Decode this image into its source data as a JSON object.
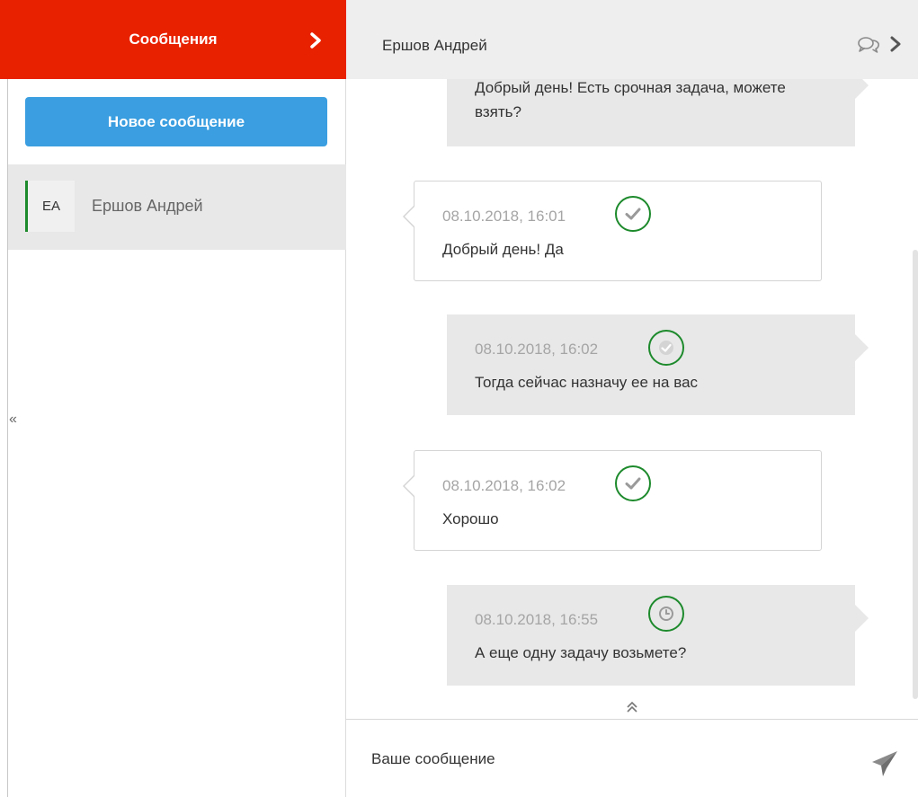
{
  "sidebar": {
    "title": "Сообщения",
    "new_message_label": "Новое сообщение",
    "contacts": [
      {
        "initials": "ЕА",
        "name": "Ершов Андрей"
      }
    ],
    "collapse_glyph": "«"
  },
  "chat": {
    "title": "Ершов Андрей",
    "messages": [
      {
        "direction": "out",
        "time": "",
        "text": "Добрый день! Есть срочная задача, можете взять?",
        "status": ""
      },
      {
        "direction": "in",
        "time": "08.10.2018, 16:01",
        "text": "Добрый день! Да",
        "status": "check-icon"
      },
      {
        "direction": "out",
        "time": "08.10.2018, 16:02",
        "text": "Тогда сейчас назначу ее на вас",
        "status": "check-icon"
      },
      {
        "direction": "in",
        "time": "08.10.2018, 16:02",
        "text": "Хорошо",
        "status": "check-icon"
      },
      {
        "direction": "out",
        "time": "08.10.2018, 16:55",
        "text": "А еще одну задачу возьмете?",
        "status": "clock-icon"
      }
    ],
    "composer": {
      "placeholder": "Ваше сообщение"
    }
  },
  "colors": {
    "header_red": "#e82200",
    "button_blue": "#3a9ee0",
    "status_green": "#1d8a2c"
  }
}
